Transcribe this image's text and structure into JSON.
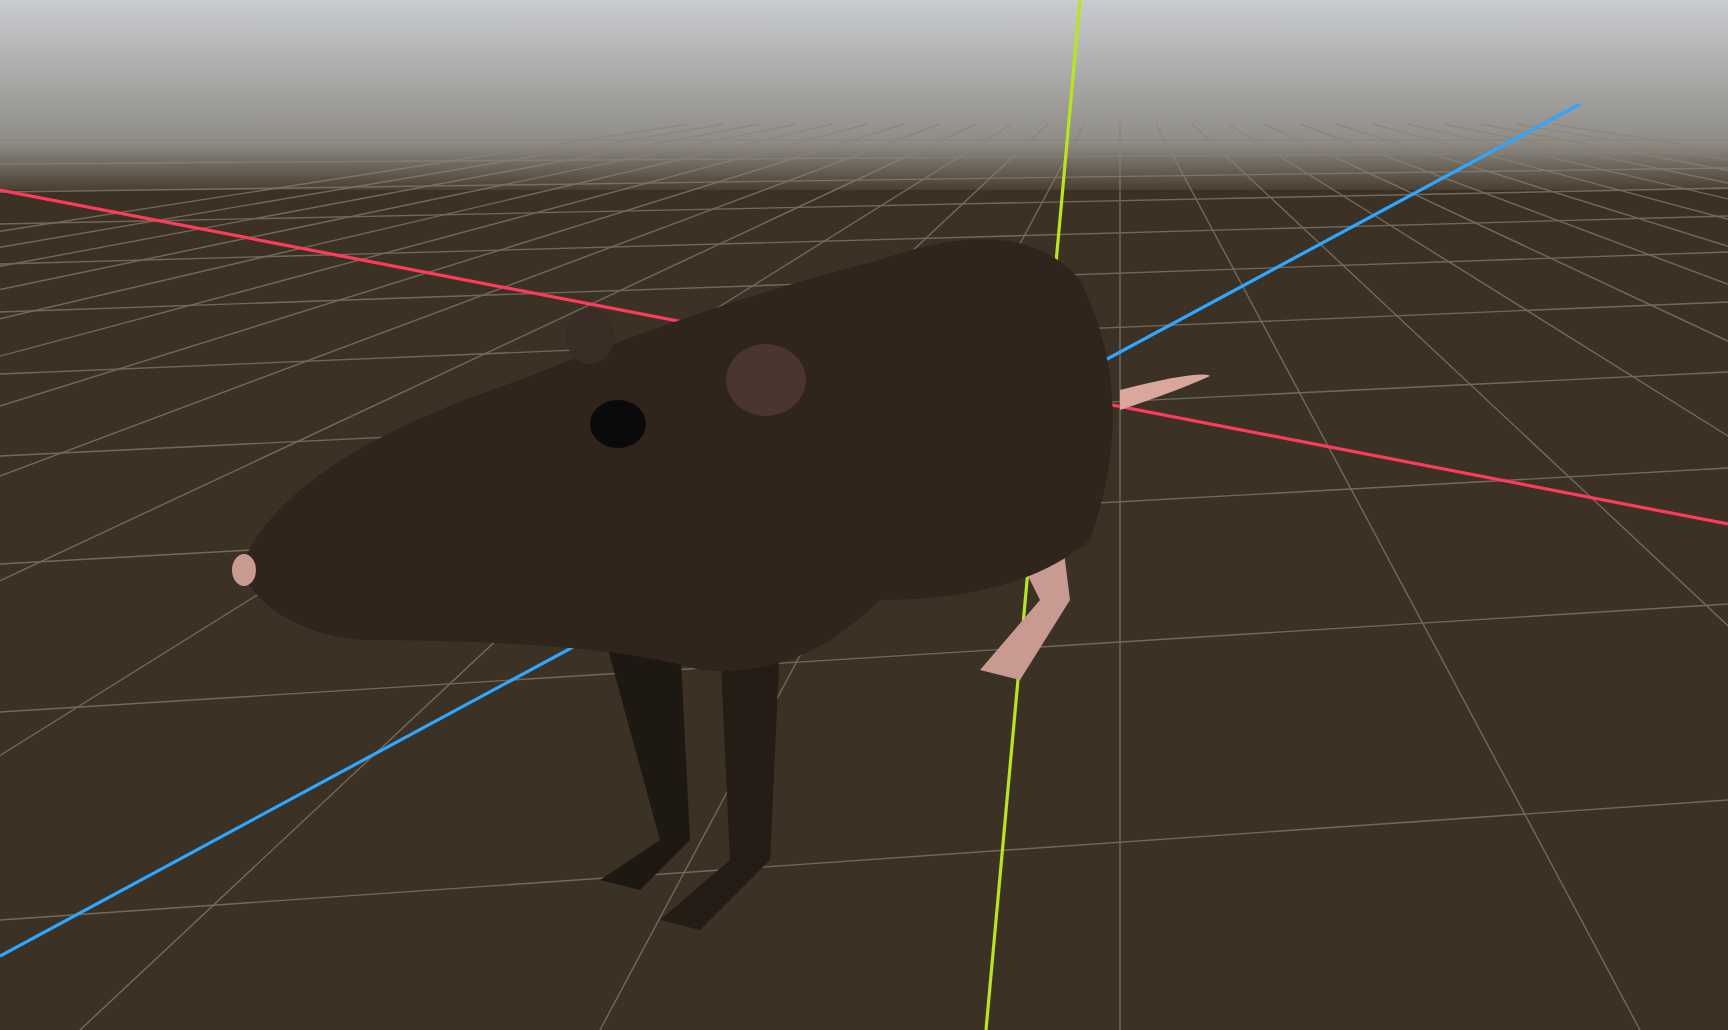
{
  "viewport": {
    "grid": true,
    "axes": [
      {
        "kind": "x",
        "color": "#ff3a5c"
      },
      {
        "kind": "y",
        "color": "#b8e61e"
      },
      {
        "kind": "z",
        "color": "#2fa6ff"
      }
    ]
  }
}
